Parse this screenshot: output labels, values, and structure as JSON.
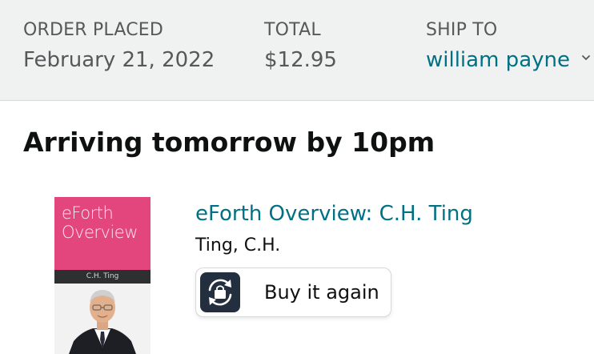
{
  "order_header": {
    "placed": {
      "label": "ORDER PLACED",
      "value": "February 21, 2022"
    },
    "total": {
      "label": "TOTAL",
      "value": "$12.95"
    },
    "ship_to": {
      "label": "SHIP TO",
      "value": "william payne",
      "icon": "chevron-down-icon"
    }
  },
  "shipment": {
    "status": "Arriving tomorrow by 10pm"
  },
  "item": {
    "cover": {
      "title_line1": "eForth",
      "title_line2": "Overview",
      "author_band": "C.H. Ting"
    },
    "title": "eForth Overview: C.H. Ting",
    "author": "Ting, C.H.",
    "buy_again": {
      "label": "Buy it again",
      "icon": "buy-again-icon"
    }
  },
  "colors": {
    "header_bg": "#f0f2f2",
    "link": "#007185",
    "muted": "#565959",
    "cover_pink": "#e2467d",
    "icon_bg": "#232f3e"
  }
}
